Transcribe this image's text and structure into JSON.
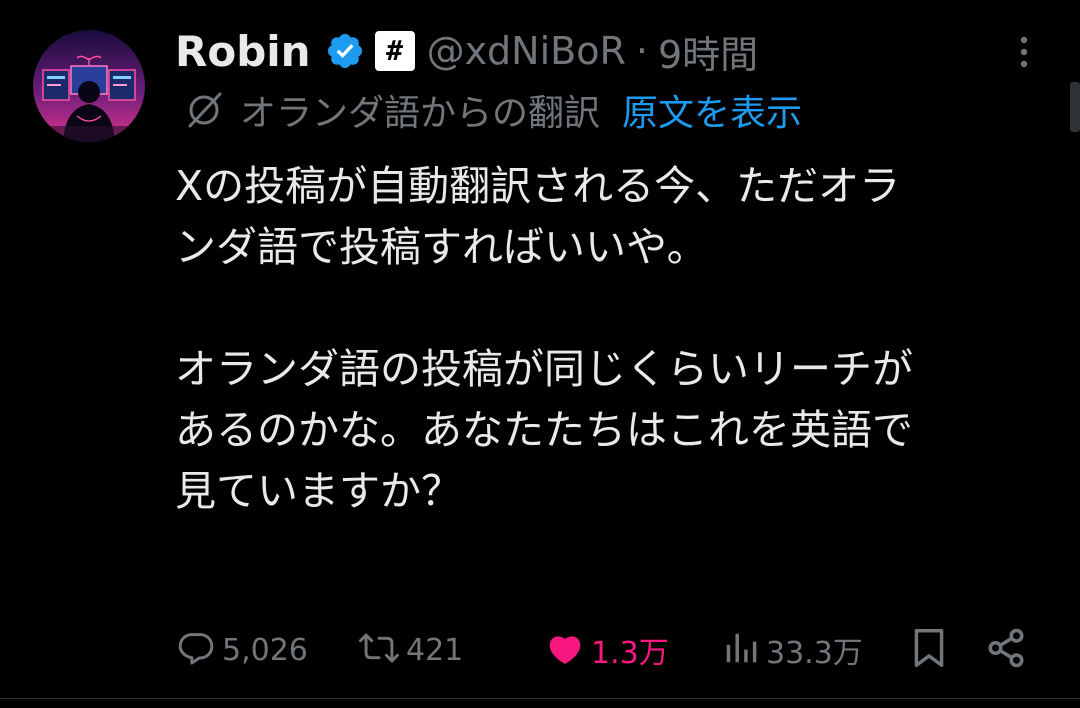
{
  "author": {
    "display_name": "Robin",
    "handle": "@xdNiBoR",
    "separator": "·",
    "time": "9時間",
    "badge_glyph": "#"
  },
  "translation": {
    "label": "オランダ語からの翻訳",
    "show_original": "原文を表示"
  },
  "post": {
    "paragraphs": [
      [
        "Xの投稿が自動翻訳される今、ただオラ",
        "ンダ語で投稿すればいいや。"
      ],
      [
        "オランダ語の投稿が同じくらいリーチが",
        "あるのかな。あなたたちはこれを英語で",
        "見ていますか？"
      ]
    ]
  },
  "actions": {
    "replies": "5,026",
    "reposts": "421",
    "likes": "1.3万",
    "views": "33.3万"
  },
  "icons": {
    "verified": "verified-badge-icon",
    "more": "more-icon",
    "translate": "translate-icon",
    "reply": "reply-icon",
    "repost": "repost-icon",
    "like": "heart-icon",
    "views": "views-icon",
    "bookmark": "bookmark-icon",
    "share": "share-icon"
  },
  "colors": {
    "background": "#000000",
    "text": "#e7e9ea",
    "muted": "#71767b",
    "link": "#1d9bf0",
    "verified": "#1d9bf0",
    "like": "#f91880"
  }
}
